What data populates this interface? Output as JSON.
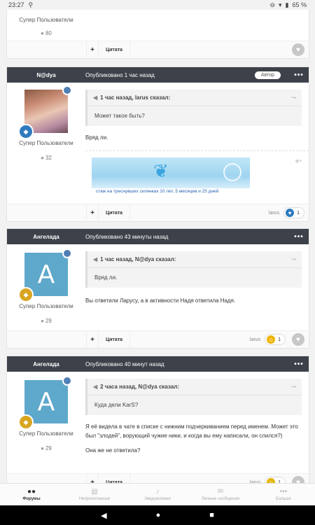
{
  "status_bar": {
    "time": "23:27",
    "battery": "65 %"
  },
  "top_partial_post": {
    "group": "Супер Пользователи",
    "count": "80",
    "quote_button": "Цитата"
  },
  "posts": [
    {
      "author": "N@dya",
      "date": "Опубликовано 1 час назад",
      "badge": "Автор",
      "group": "Супер Пользователи",
      "count": "32",
      "quote_header": "1 час назад, larus сказал:",
      "quote_text": "Может такое быть?",
      "text": "Вряд ли.",
      "signature_text": "стаж на треснувших склянках  10 лет, 5 месяцев и 25 дней",
      "quote_button": "Цитата",
      "react_user": "larus",
      "react_count": "1"
    },
    {
      "author": "Ангелада",
      "date": "Опубликовано 43 минуты назад",
      "group": "Супер Пользователи",
      "avatar_letter": "A",
      "count": "29",
      "quote_header": "1 час назад, N@dya сказал:",
      "quote_text": "Вряд ли.",
      "text": "Вы ответили Ларусу, а в активности Надя ответила Надя.",
      "quote_button": "Цитата",
      "react_user": "larus",
      "react_count": "1"
    },
    {
      "author": "Ангелада",
      "date": "Опубликовано 40 минут назад",
      "group": "Супер Пользователи",
      "avatar_letter": "A",
      "count": "29",
      "quote_header": "2 часа назад, N@dya сказал:",
      "quote_text": "Куда дели KarS?",
      "text1": "Я её видела в чате в списке с нижним подчеркиванием перед именем. Может это был \"злодей\", ворующий чужие ники, и когда вы ему написали, он слился?)",
      "text2": "Она же не ответила?",
      "quote_button": "Цитата",
      "react_user": "larus",
      "react_count": "1"
    }
  ],
  "bottom_nav": [
    {
      "label": "Форумы",
      "icon": "forums-icon"
    },
    {
      "label": "Непрочитанные",
      "icon": "unread-icon"
    },
    {
      "label": "Уведомления",
      "icon": "bell-icon"
    },
    {
      "label": "Личные сообщения",
      "icon": "mail-icon"
    },
    {
      "label": "Больше",
      "icon": "more-icon"
    }
  ],
  "colors": {
    "header": "#3d4149",
    "avatar_blue": "#5ea8cc",
    "link_blue": "#2a62b5"
  }
}
